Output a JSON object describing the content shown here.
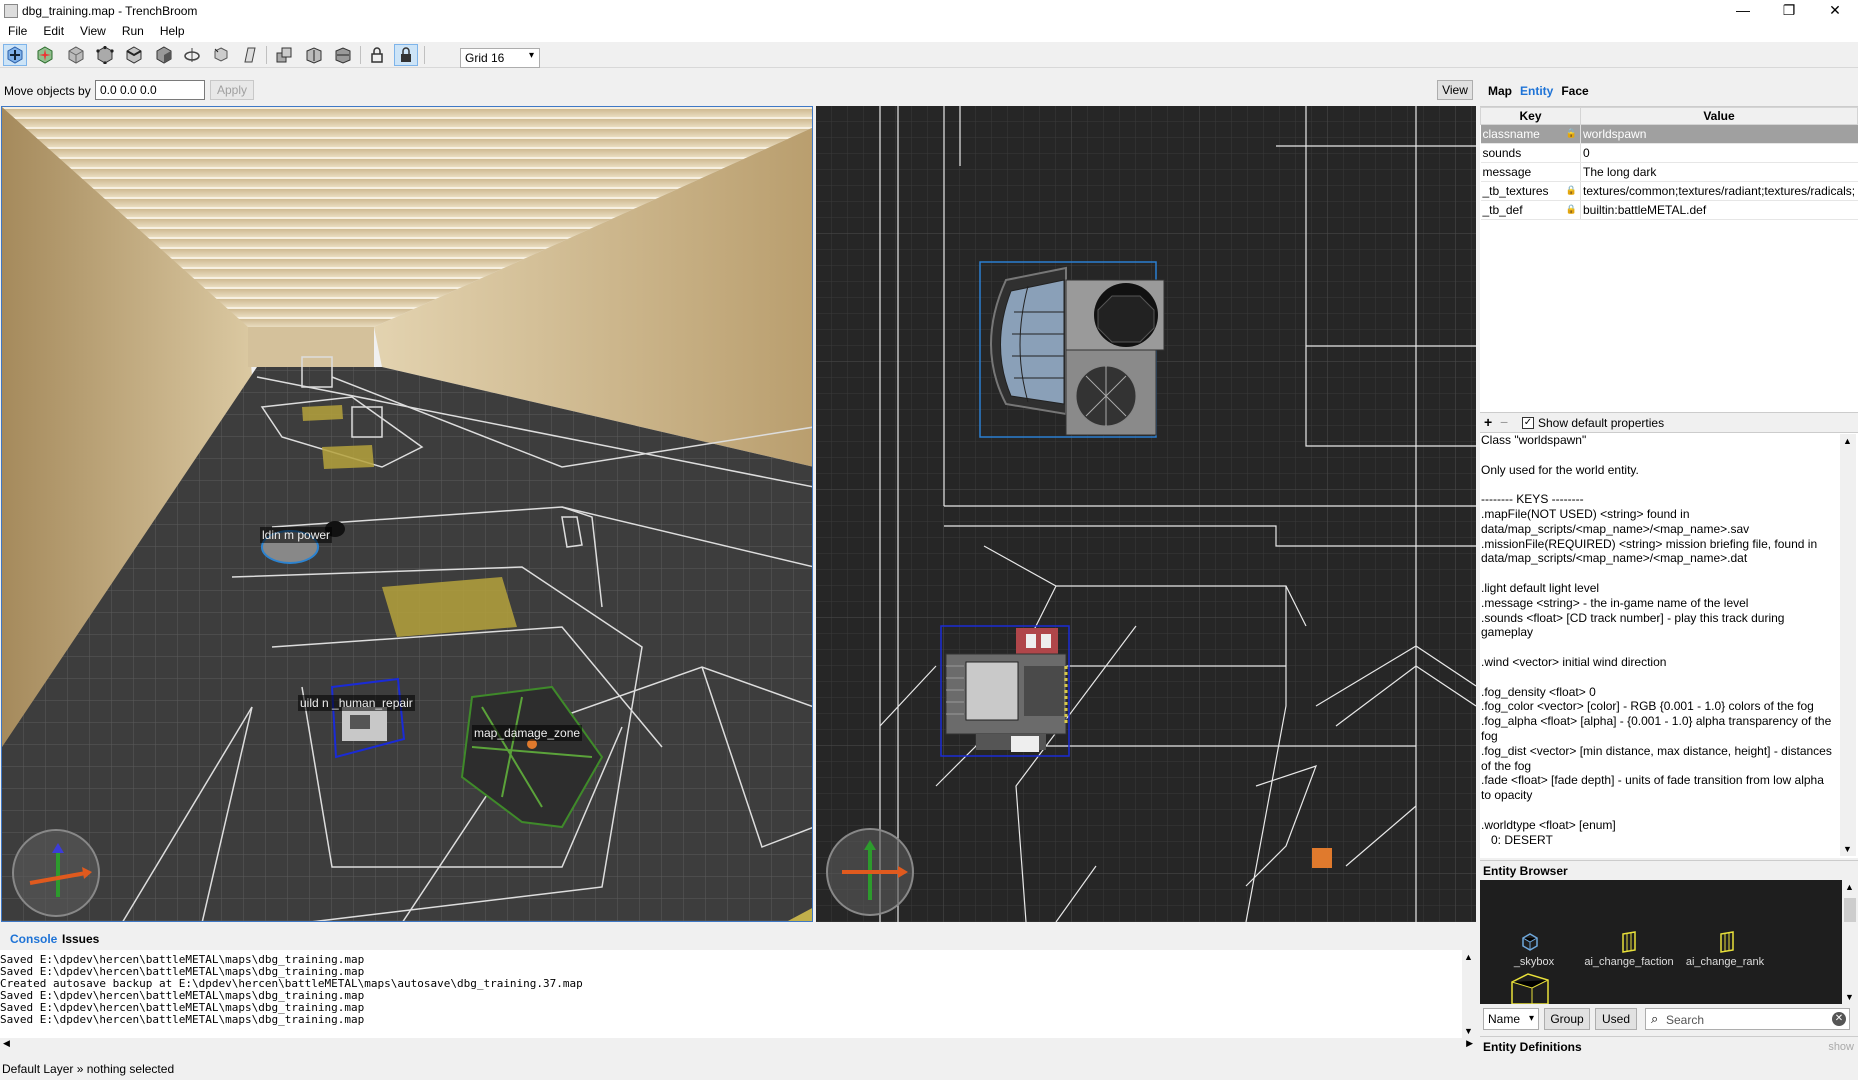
{
  "window": {
    "title": "dbg_training.map - TrenchBroom",
    "controls": [
      "—",
      "❐",
      "✕"
    ]
  },
  "menu": [
    "File",
    "Edit",
    "View",
    "Run",
    "Help"
  ],
  "toolbar": {
    "grid_value": "Grid 16"
  },
  "move_bar": {
    "label": "Move objects by",
    "value": "0.0 0.0 0.0",
    "apply_label": "Apply",
    "view_label": "View"
  },
  "viewport3d": {
    "labels": {
      "power": "ldin  m  power",
      "repair": "uild  n  _human_repair",
      "damage": "map_damage_zone"
    }
  },
  "inspector": {
    "tabs": [
      "Map",
      "Entity",
      "Face"
    ],
    "active_tab": "Entity",
    "columns": {
      "key": "Key",
      "value": "Value"
    },
    "properties": [
      {
        "key": "classname",
        "value": "worldspawn",
        "locked": true
      },
      {
        "key": "sounds",
        "value": "0",
        "locked": false
      },
      {
        "key": "message",
        "value": "The long dark",
        "locked": false
      },
      {
        "key": "_tb_textures",
        "value": "textures/common;textures/radiant;textures/radicals;",
        "locked": true
      },
      {
        "key": "_tb_def",
        "value": "builtin:battleMETAL.def",
        "locked": true
      }
    ],
    "add_label": "+",
    "remove_label": "−",
    "show_default": "Show default properties",
    "docs": [
      "Class \"worldspawn\"",
      "",
      "Only used for the world entity.",
      "",
      "-------- KEYS --------",
      ".mapFile(NOT USED) <string> found in",
      "data/map_scripts/<map_name>/<map_name>.sav",
      ".missionFile(REQUIRED) <string> mission briefing file, found in",
      "data/map_scripts/<map_name>/<map_name>.dat",
      "",
      ".light default light level",
      ".message <string> - the in-game name of the level",
      ".sounds <float> [CD track number] - play this track during",
      "gameplay",
      "",
      ".wind <vector> initial wind direction",
      "",
      ".fog_density <float> 0",
      ".fog_color <vector> [color] - RGB {0.001 - 1.0} colors of the fog",
      ".fog_alpha <float> [alpha] - {0.001 - 1.0} alpha transparency of the",
      "fog",
      ".fog_dist <vector> [min distance, max distance, height] - distances",
      "of the fog",
      ".fade <float> [fade depth] - units of fade transition from low alpha",
      "to opacity",
      "",
      ".worldtype <float> [enum]",
      "   0: DESERT"
    ]
  },
  "entity_browser": {
    "title": "Entity Browser",
    "items": [
      "_skybox",
      "ai_change_faction",
      "ai_change_rank"
    ],
    "sort_value": "Name",
    "group_label": "Group",
    "used_label": "Used",
    "search_placeholder": "Search",
    "definitions_label": "Entity Definitions",
    "show_label": "show"
  },
  "console": {
    "tabs": [
      "Console",
      "Issues"
    ],
    "active_tab": "Console",
    "lines": [
      "Saved E:\\dpdev\\hercen\\battleMETAL\\maps\\dbg_training.map",
      "Saved E:\\dpdev\\hercen\\battleMETAL\\maps\\dbg_training.map",
      "Created autosave backup at E:\\dpdev\\hercen\\battleMETAL\\maps\\autosave\\dbg_training.37.map",
      "Saved E:\\dpdev\\hercen\\battleMETAL\\maps\\dbg_training.map",
      "Saved E:\\dpdev\\hercen\\battleMETAL\\maps\\dbg_training.map",
      "Saved E:\\dpdev\\hercen\\battleMETAL\\maps\\dbg_training.map"
    ]
  },
  "status": "Default Layer » nothing selected",
  "colors": {
    "accent": "#1e73d6",
    "viewport_bg": "#222222",
    "selection_blue": "#3f78c5"
  }
}
